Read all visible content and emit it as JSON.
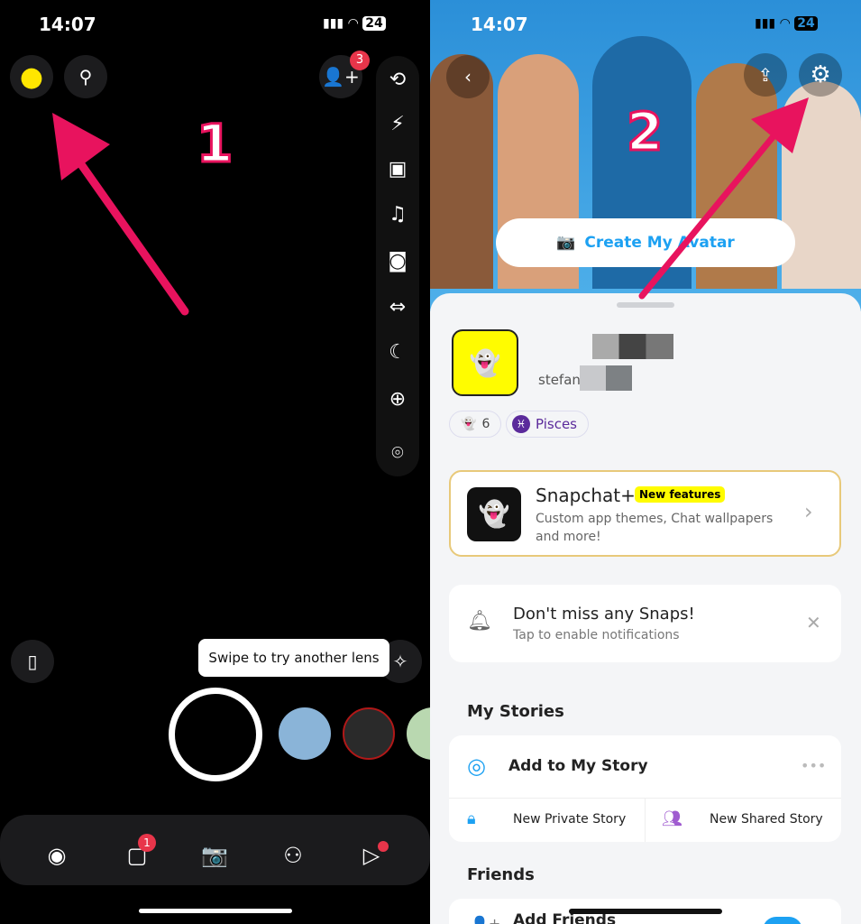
{
  "left": {
    "status_time": "14:07",
    "battery": "24",
    "add_friend_badge": "3",
    "step_label": "1",
    "tooltip": "Swipe to try another lens",
    "chat_badge": "1",
    "icons": [
      "profile-icon",
      "search-icon",
      "add-friend-icon",
      "flip-camera-icon",
      "flash-off-icon",
      "video-icon",
      "music-icon",
      "multi-snap-icon",
      "dual-camera-icon",
      "night-mode-icon",
      "plus-icon",
      "scan-icon",
      "memories-icon",
      "lens-explore-icon",
      "map-icon",
      "chat-icon",
      "camera-icon",
      "friends-icon",
      "spotlight-icon"
    ]
  },
  "right": {
    "status_time": "14:07",
    "battery": "24",
    "step_label": "2",
    "create_avatar": "Create My Avatar",
    "username_prefix": "stefan",
    "snapstar_count": "6",
    "zodiac": "Pisces",
    "snapchat_plus": {
      "title": "Snapchat+",
      "badge": "New features",
      "desc": "Custom app themes, Chat wallpapers and more!"
    },
    "notifications": {
      "title": "Don't miss any Snaps!",
      "subtitle": "Tap to enable notifications"
    },
    "my_stories": {
      "heading": "My Stories",
      "add": "Add to My Story",
      "private": "New Private Story",
      "shared": "New Shared Story"
    },
    "friends": {
      "heading": "Friends",
      "add": "Add Friends"
    },
    "colors": {
      "accent": "#1da1f2",
      "arrow": "#e8135e",
      "snap_yellow": "#fffc00",
      "purple": "#5b2a9b"
    }
  }
}
